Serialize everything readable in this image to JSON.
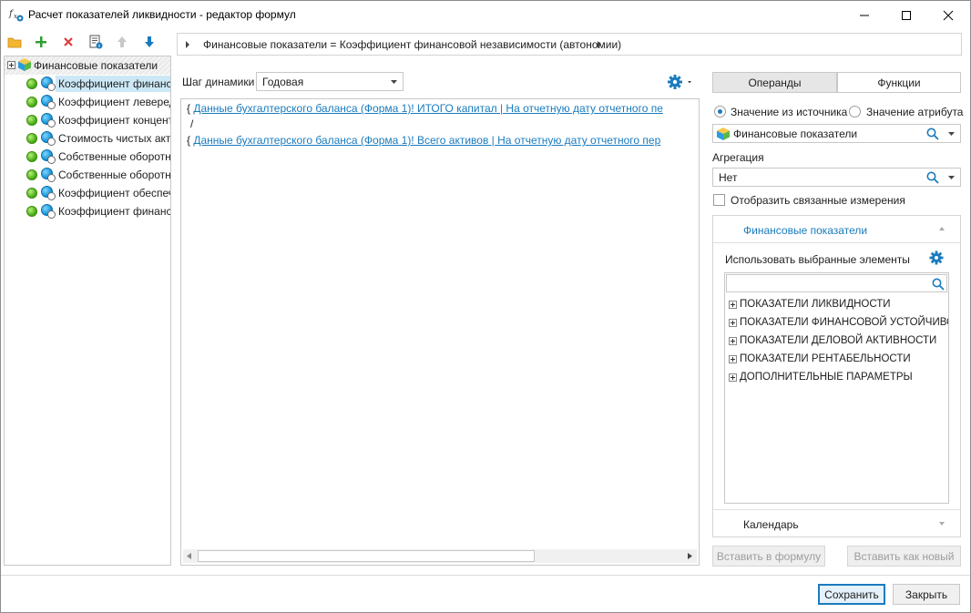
{
  "window": {
    "title": "Расчет показателей ликвидности - редактор формул"
  },
  "tree": {
    "root_label": "Финансовые показатели",
    "items": [
      "Коэффициент финансов",
      "Коэффициент левередж",
      "Коэффициент концентр",
      "Стоимость чистых акти",
      "Собственные оборотны",
      "Собственные оборотны",
      "Коэффициент обеспечен",
      "Коэффициент финансов"
    ]
  },
  "breadcrumb": {
    "text": "Финансовые показатели = Коэффициент финансовой независимости (автономии)"
  },
  "step": {
    "label": "Шаг динамики",
    "value": "Годовая"
  },
  "formula": {
    "line1_prefix": "{",
    "line1_link": "Данные бухгалтерского баланса (Форма 1)! ИТОГО капитал | На отчетную дату отчетного пе",
    "line2": "/",
    "line3_prefix": "{",
    "line3_link": "Данные бухгалтерского баланса (Форма 1)! Всего активов | На отчетную дату отчетного пер"
  },
  "tabs": {
    "operands": "Операнды",
    "functions": "Функции"
  },
  "source": {
    "radio_source": "Значение из источника",
    "radio_attr": "Значение атрибута",
    "value": "Финансовые показатели"
  },
  "aggregation": {
    "label": "Агрегация",
    "value": "Нет"
  },
  "show_linked": "Отобразить связанные измерения",
  "panel": {
    "header": "Финансовые показатели",
    "use_selected": "Использовать выбранные элементы",
    "search_placeholder": "",
    "items": [
      "ПОКАЗАТЕЛИ ЛИКВИДНОСТИ",
      "ПОКАЗАТЕЛИ ФИНАНСОВОЙ УСТОЙЧИВОСТИ",
      "ПОКАЗАТЕЛИ ДЕЛОВОЙ АКТИВНОСТИ",
      "ПОКАЗАТЕЛИ РЕНТАБЕЛЬНОСТИ",
      "ДОПОЛНИТЕЛЬНЫЕ ПАРАМЕТРЫ"
    ],
    "calendar": "Календарь"
  },
  "buttons": {
    "insert": "Вставить в формулу",
    "insert_new": "Вставить как новый",
    "save": "Сохранить",
    "close": "Закрыть"
  },
  "colors": {
    "accent": "#1a7bbd",
    "link": "#1a7bbd",
    "selection": "#cce8f6"
  }
}
